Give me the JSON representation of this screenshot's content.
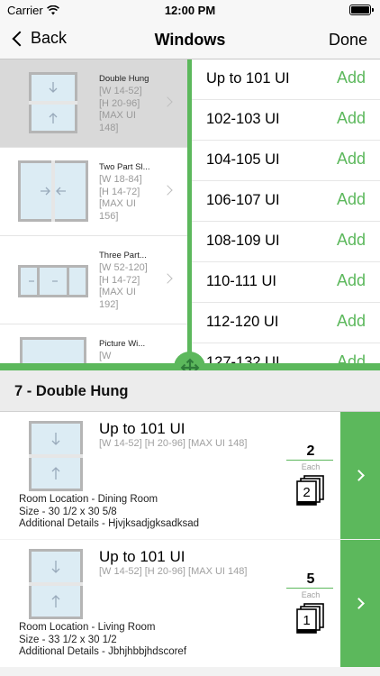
{
  "status_bar": {
    "carrier": "Carrier",
    "time": "12:00 PM",
    "icons": [
      "wifi-icon",
      "battery-icon"
    ]
  },
  "nav": {
    "back_label": "Back",
    "title": "Windows",
    "done_label": "Done"
  },
  "window_types": [
    {
      "name": "Double Hung",
      "dims": "[W 14-52] [H 20-96] [MAX UI 148]",
      "selected": true
    },
    {
      "name": "Two Part Sl...",
      "dims": "[W 18-84] [H 14-72] [MAX UI 156]",
      "selected": false
    },
    {
      "name": "Three Part...",
      "dims": "[W 52-120] [H 14-72] [MAX UI 192]",
      "selected": false
    },
    {
      "name": "Picture Wi...",
      "dims": "[W",
      "selected": false
    }
  ],
  "ui_ranges": {
    "add_label": "Add",
    "items": [
      "Up to 101 UI",
      "102-103 UI",
      "104-105 UI",
      "106-107 UI",
      "108-109 UI",
      "110-111 UI",
      "112-120 UI",
      "127-132 UI"
    ]
  },
  "section": {
    "title": "7 - Double Hung"
  },
  "orders": [
    {
      "title": "Up to 101 UI",
      "dims": "[W 14-52] [H 20-96] [MAX UI 148]",
      "quantity": "2",
      "each_label": "Each",
      "copies": "2",
      "room": "Room Location - Dining Room",
      "size": "Size - 30 1/2 x 30 5/8",
      "details": "Additional Details - Hjvjksadjgksadksad"
    },
    {
      "title": "Up to 101 UI",
      "dims": "[W 14-52] [H 20-96] [MAX UI 148]",
      "quantity": "5",
      "each_label": "Each",
      "copies": "1",
      "room": "Room Location - Living Room",
      "size": "Size - 33 1/2 x 30 1/2",
      "details": "Additional Details - Jbhjhbbjhdscoref"
    }
  ],
  "colors": {
    "accent": "#5cb85c",
    "selected_row": "#d9d9d9",
    "muted_text": "#9a9a9a",
    "header_bg": "#ececec"
  }
}
